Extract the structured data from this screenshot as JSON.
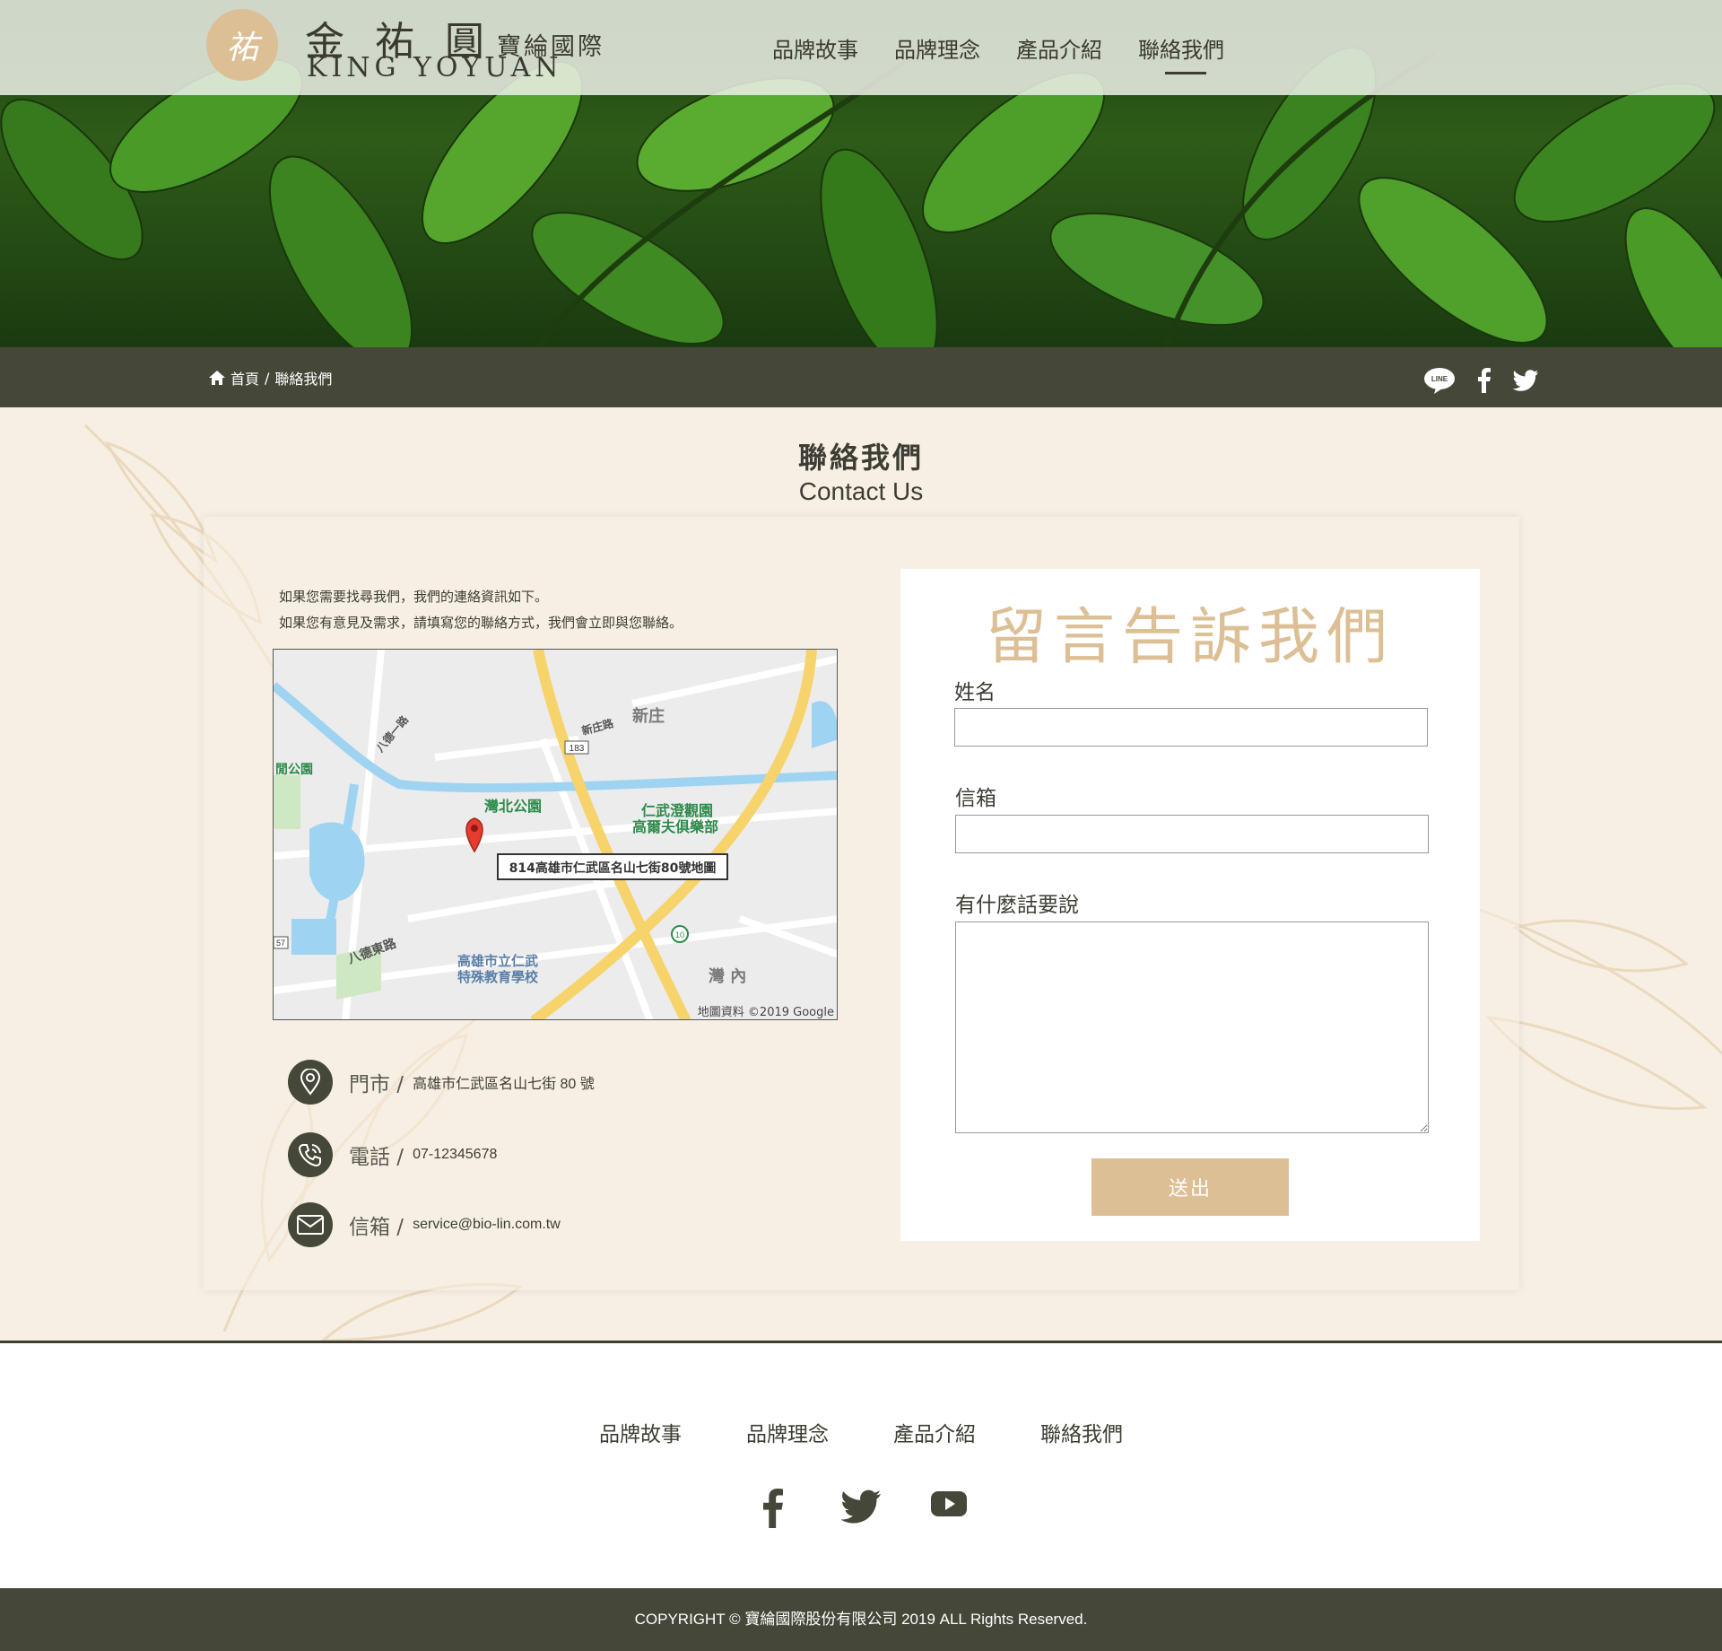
{
  "brand": {
    "logo_glyph": "祐",
    "name_zh": "金 祐 圓",
    "name_zh_sub": "寶綸國際",
    "name_en": "KING YOYUAN"
  },
  "nav": [
    {
      "label": "品牌故事"
    },
    {
      "label": "品牌理念"
    },
    {
      "label": "產品介紹"
    },
    {
      "label": "聯絡我們",
      "active": true
    }
  ],
  "breadcrumb": {
    "home": "首頁",
    "separator": "/",
    "current": "聯絡我們"
  },
  "top_social": [
    "line-icon",
    "facebook-icon",
    "twitter-icon"
  ],
  "page": {
    "title_zh": "聯絡我們",
    "title_en": "Contact Us"
  },
  "intro": [
    "如果您需要找尋我們，我們的連絡資訊如下。",
    "如果您有意見及需求，請填寫您的聯絡方式，我們會立即與您聯絡。"
  ],
  "map": {
    "marker_label": "814高雄市仁武區名山七街80號地圖",
    "attribution": "地圖資料 ©2019 Google",
    "places": {
      "p1": "新庄",
      "p2": "灣北公園",
      "p3": "仁武澄觀園",
      "p4": "高爾夫俱樂部",
      "p5": "高雄市立仁武",
      "p6": "特殊教育學校",
      "p7": "灣 內",
      "p8": "八德東路",
      "p9": "新庄路",
      "p10": "八德一路",
      "p11": "183",
      "p12": "10",
      "p13": "57",
      "p14": "閒公園"
    }
  },
  "contact": {
    "store_label": "門市 /",
    "store_value": "高雄市仁武區名山七街 80 號",
    "phone_label": "電話 /",
    "phone_value": "07-12345678",
    "email_label": "信箱 /",
    "email_value": "service@bio-lin.com.tw"
  },
  "form": {
    "title": "留言告訴我們",
    "name_label": "姓名",
    "email_label": "信箱",
    "message_label": "有什麼話要說",
    "submit_label": "送出"
  },
  "footer": {
    "nav": [
      "品牌故事",
      "品牌理念",
      "產品介紹",
      "聯絡我們"
    ],
    "social": [
      "facebook-icon",
      "twitter-icon",
      "youtube-icon"
    ],
    "copyright": "COPYRIGHT © 寶綸國際股份有限公司 2019 ALL Rights Reserved."
  },
  "colors": {
    "dark": "#454838",
    "accent": "#dcbf95",
    "bg": "#f7efe4",
    "leaf": "#2e5c18"
  }
}
